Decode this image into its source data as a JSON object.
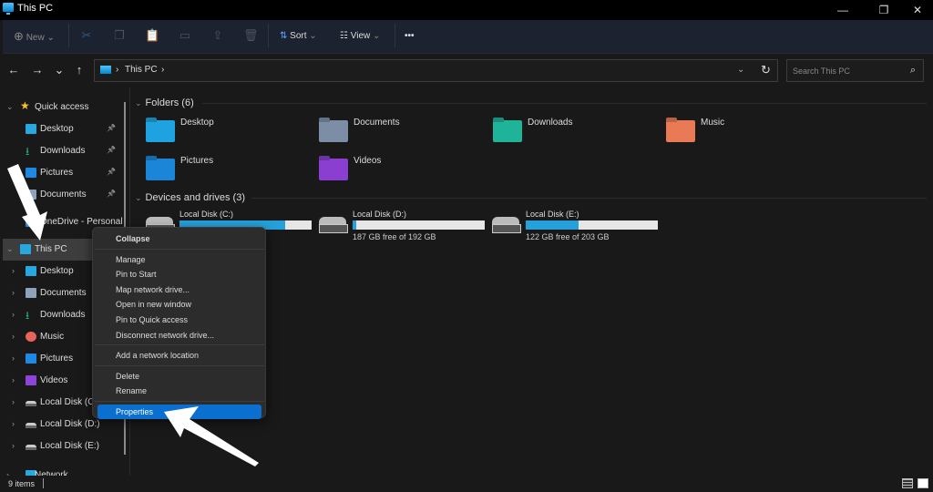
{
  "window": {
    "title": "This PC",
    "controls": {
      "minimize": "—",
      "maximize": "❐",
      "close": "✕"
    }
  },
  "toolbar": {
    "new_label": "New",
    "sort_label": "Sort",
    "view_label": "View",
    "more_label": "•••",
    "icons": [
      "cut-icon",
      "copy-icon",
      "paste-icon",
      "rename-icon",
      "share-icon",
      "delete-icon"
    ]
  },
  "navigation": {
    "back": "←",
    "forward": "→",
    "recent": "⌄",
    "up": "↑",
    "breadcrumb": [
      "This PC"
    ],
    "search_placeholder": "Search This PC"
  },
  "sidebar": {
    "items": [
      {
        "label": "Quick access",
        "icon": "star-icon",
        "color": "#f7c325",
        "expanded": true
      },
      {
        "label": "Desktop",
        "icon": "desktop-folder-icon",
        "color": "#29a8e0",
        "pinned": true
      },
      {
        "label": "Downloads",
        "icon": "download-icon",
        "color": "#1fb37f",
        "pinned": true
      },
      {
        "label": "Pictures",
        "icon": "pictures-icon",
        "color": "#1e88e5",
        "pinned": true
      },
      {
        "label": "Documents",
        "icon": "documents-icon",
        "color": "#8fa2bb",
        "pinned": true
      },
      {
        "label": "OneDrive - Personal",
        "icon": "onedrive-icon",
        "color": "#2b89d9"
      },
      {
        "label": "This PC",
        "icon": "this-pc-icon",
        "color": "#29a8e0",
        "expanded": true,
        "selected": true
      },
      {
        "label": "Desktop",
        "icon": "desktop-folder-icon",
        "color": "#29a8e0"
      },
      {
        "label": "Documents",
        "icon": "documents-icon",
        "color": "#8fa2bb"
      },
      {
        "label": "Downloads",
        "icon": "download-icon",
        "color": "#1fb37f"
      },
      {
        "label": "Music",
        "icon": "music-icon",
        "color": "#e8645a"
      },
      {
        "label": "Pictures",
        "icon": "pictures-icon",
        "color": "#1e88e5"
      },
      {
        "label": "Videos",
        "icon": "videos-icon",
        "color": "#8e44d6"
      },
      {
        "label": "Local Disk (C:)",
        "icon": "drive-c-icon",
        "color": "#bbbbbb"
      },
      {
        "label": "Local Disk (D:)",
        "icon": "drive-icon",
        "color": "#bbbbbb"
      },
      {
        "label": "Local Disk (E:)",
        "icon": "drive-icon",
        "color": "#bbbbbb"
      },
      {
        "label": "Network",
        "icon": "network-icon",
        "color": "#29a8e0"
      }
    ]
  },
  "content": {
    "folders_header": "Folders (6)",
    "folders": [
      {
        "name": "Desktop",
        "color": "#1fa3e0"
      },
      {
        "name": "Documents",
        "color": "#7c8ea6"
      },
      {
        "name": "Downloads",
        "color": "#1fb39a"
      },
      {
        "name": "Music",
        "color": "#e97a55"
      },
      {
        "name": "Pictures",
        "color": "#1b86d8"
      },
      {
        "name": "Videos",
        "color": "#8a3fd1"
      }
    ],
    "drives_header": "Devices and drives (3)",
    "drives": [
      {
        "name": "Local Disk (C:)",
        "used_fraction": 0.8,
        "status": ""
      },
      {
        "name": "Local Disk (D:)",
        "used_fraction": 0.03,
        "status": "187 GB free of 192 GB"
      },
      {
        "name": "Local Disk (E:)",
        "used_fraction": 0.4,
        "status": "122 GB free of 203 GB"
      }
    ]
  },
  "context_menu": {
    "groups": [
      [
        "Collapse"
      ],
      [
        "Manage",
        "Pin to Start",
        "Map network drive...",
        "Open in new window",
        "Pin to Quick access",
        "Disconnect network drive..."
      ],
      [
        "Add a network location"
      ],
      [
        "Delete",
        "Rename"
      ],
      [
        "Properties"
      ]
    ],
    "highlighted": "Properties"
  },
  "status": {
    "item_count": "9 items"
  },
  "colors": {
    "accent": "#0a6fcf",
    "drive_bar": "#26a0da"
  }
}
